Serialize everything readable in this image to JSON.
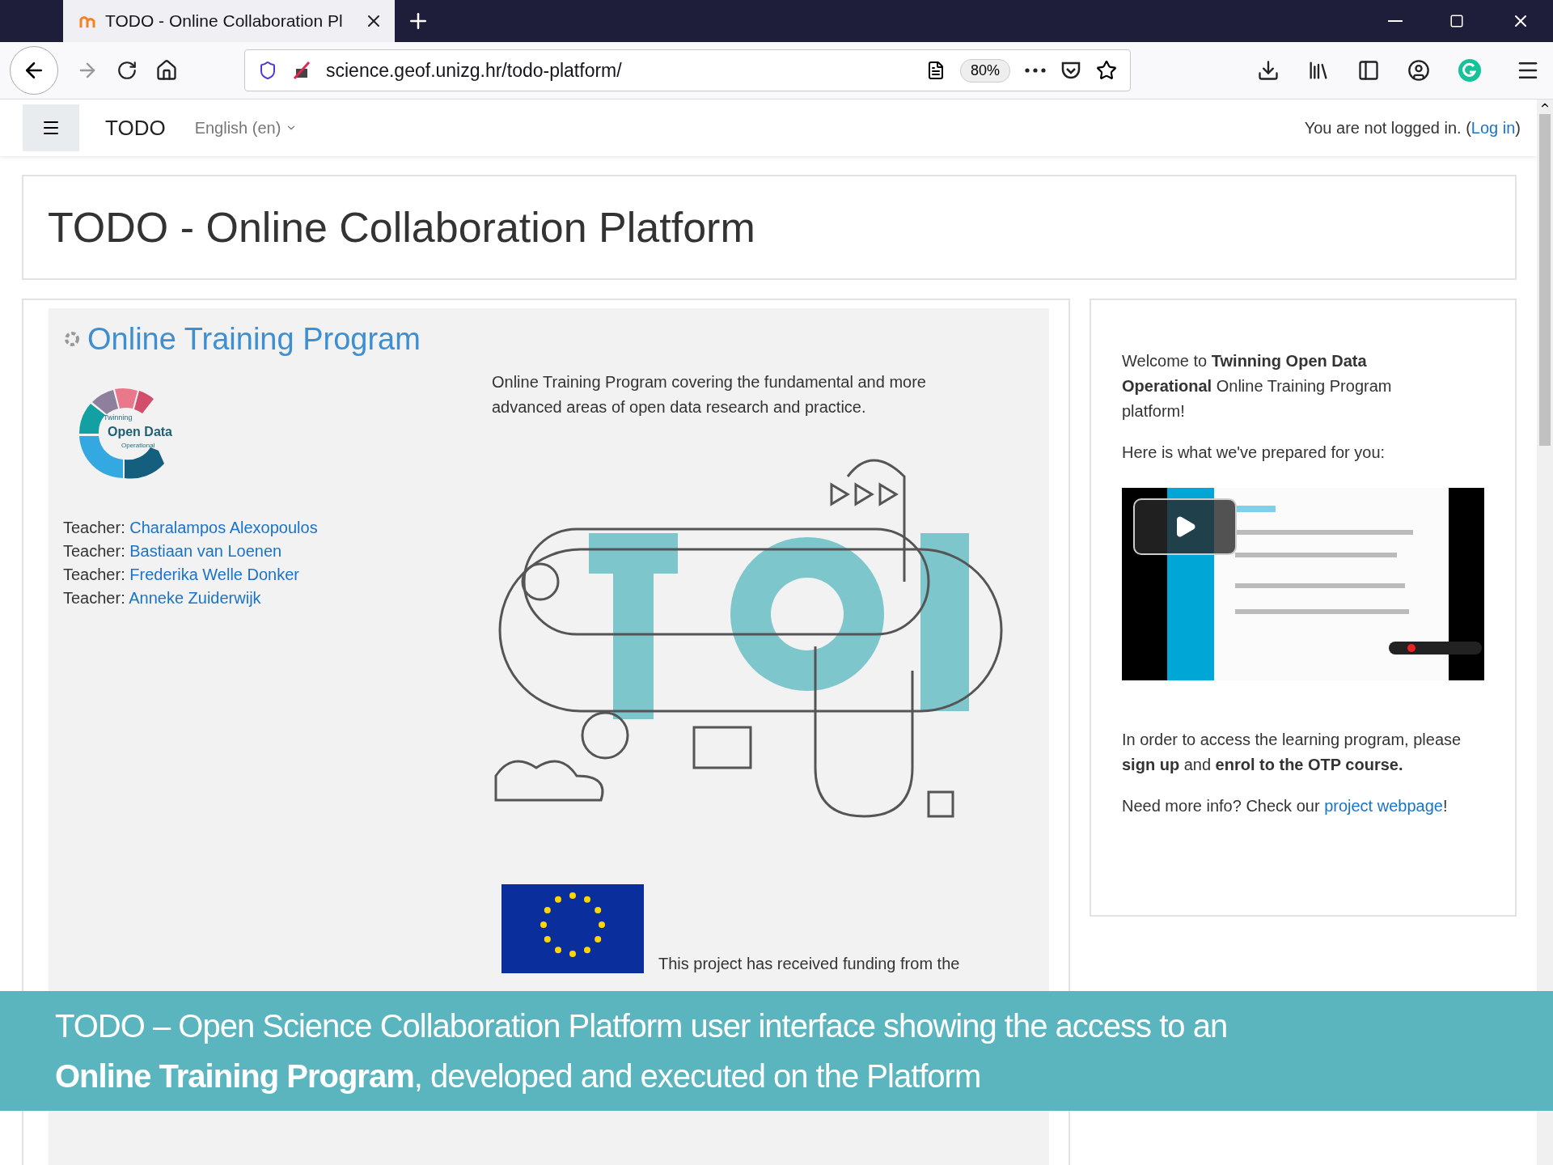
{
  "browser": {
    "tab_title": "TODO - Online Collaboration Pl",
    "url": "science.geof.unizg.hr/todo-platform/",
    "zoom": "80%"
  },
  "navbar": {
    "brand": "TODO",
    "language": "English (en)",
    "login_before": "You are not logged in. (",
    "login_link": "Log in",
    "login_after": ")"
  },
  "page_title": "TODO - Online Collaboration Platform",
  "course": {
    "title": "Online Training Program",
    "logo": {
      "top": "Twinning",
      "main": "Open Data",
      "bottom": "Operational"
    },
    "teachers": [
      {
        "role": "Teacher:",
        "name": "Charalampos Alexopoulos"
      },
      {
        "role": "Teacher:",
        "name": "Bastiaan van Loenen"
      },
      {
        "role": "Teacher:",
        "name": "Frederika Welle Donker"
      },
      {
        "role": "Teacher:",
        "name": "Anneke Zuiderwijk"
      }
    ],
    "summary": "Online Training Program covering the fundamental and more advanced areas of open data research and practice.",
    "funding": "This project has received funding from the"
  },
  "sidebar": {
    "welcome": "Welcome to **Twinning Open Data Operational** Online Training Program platform!",
    "prepared": "Here is what we've prepared for you:",
    "access": "In order to access the learning program, please **sign up** and **enrol to the OTP course.**",
    "info_before": "Need more info? Check our ",
    "info_link": "project webpage",
    "info_after": "!"
  },
  "caption": "TODO – Open Science Collaboration Platform user interface showing the access to an **Online Training Program**, developed and executed on the Platform"
}
